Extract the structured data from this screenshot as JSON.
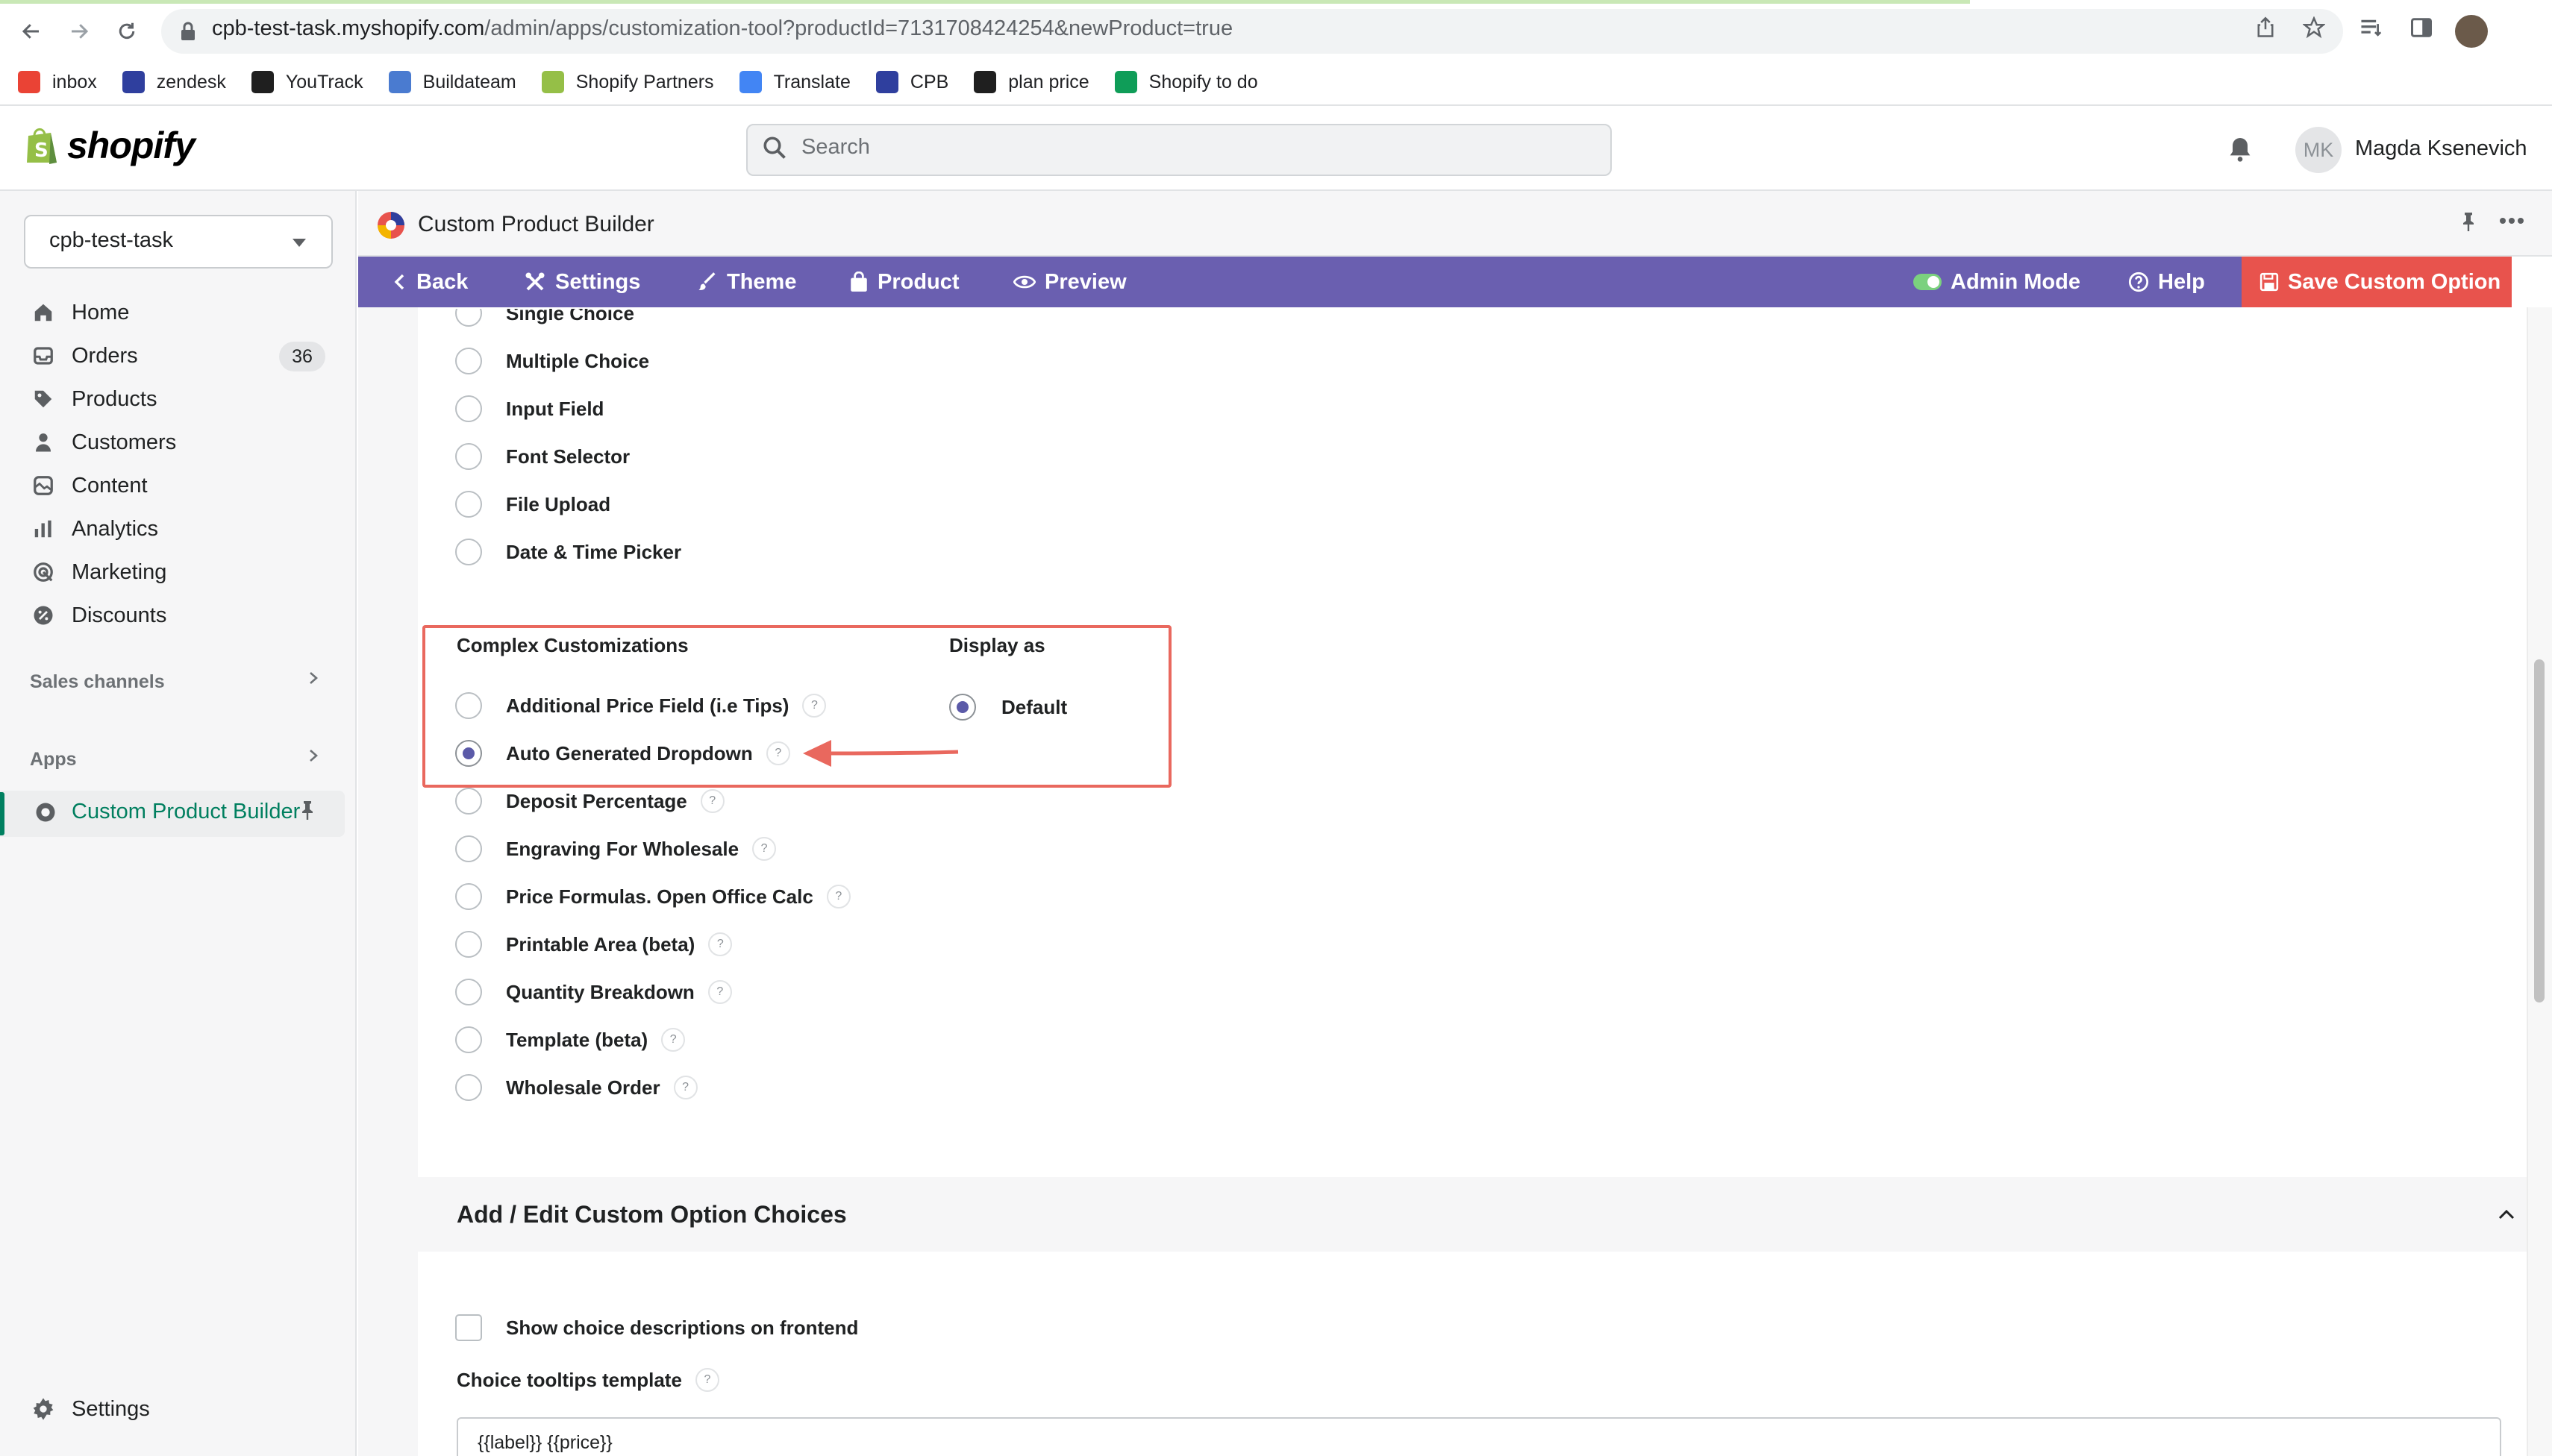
{
  "browser": {
    "url_host": "cpb-test-task.myshopify.com",
    "url_path": "/admin/apps/customization-tool?productId=7131708424254&newProduct=true",
    "bookmarks": [
      {
        "label": "inbox",
        "icon": "gmail-icon",
        "color": "#ea4335"
      },
      {
        "label": "zendesk",
        "icon": "zendesk-icon",
        "color": "#2f3f9e"
      },
      {
        "label": "YouTrack",
        "icon": "youtrack-icon",
        "color": "#1f1f1f"
      },
      {
        "label": "Buildateam",
        "icon": "buildateam-icon",
        "color": "#4a7bd0"
      },
      {
        "label": "Shopify Partners",
        "icon": "shopify-icon",
        "color": "#95bf47"
      },
      {
        "label": "Translate",
        "icon": "translate-icon",
        "color": "#4285f4"
      },
      {
        "label": "CPB",
        "icon": "cpb-icon",
        "color": "#2f3f9e"
      },
      {
        "label": "plan price",
        "icon": "shopify-bag-icon",
        "color": "#1f1f1f"
      },
      {
        "label": "Shopify to do",
        "icon": "sheets-icon",
        "color": "#0f9d58"
      }
    ]
  },
  "topbar": {
    "logo_text": "shopify",
    "search_placeholder": "Search",
    "avatar_initials": "MK",
    "user_name": "Magda Ksenevich"
  },
  "sidebar": {
    "store_name": "cpb-test-task",
    "nav": [
      {
        "label": "Home",
        "icon": "home-icon"
      },
      {
        "label": "Orders",
        "icon": "orders-icon",
        "badge": "36"
      },
      {
        "label": "Products",
        "icon": "tag-icon"
      },
      {
        "label": "Customers",
        "icon": "person-icon"
      },
      {
        "label": "Content",
        "icon": "content-icon"
      },
      {
        "label": "Analytics",
        "icon": "bar-chart-icon"
      },
      {
        "label": "Marketing",
        "icon": "target-icon"
      },
      {
        "label": "Discounts",
        "icon": "discount-icon"
      }
    ],
    "sales_channels_label": "Sales channels",
    "apps_label": "Apps",
    "active_app": "Custom Product Builder",
    "settings_label": "Settings"
  },
  "app_header": {
    "title": "Custom Product Builder"
  },
  "toolbar": {
    "back": "Back",
    "settings": "Settings",
    "theme": "Theme",
    "product": "Product",
    "preview": "Preview",
    "admin_mode": "Admin Mode",
    "help": "Help",
    "save": "Save Custom Option",
    "colors": {
      "bar": "#6a5fb0",
      "save": "#e8534d"
    }
  },
  "basic_options": [
    "Single Choice",
    "Multiple Choice",
    "Input Field",
    "Font Selector",
    "File Upload",
    "Date & Time Picker"
  ],
  "complex": {
    "heading": "Complex Customizations",
    "display_heading": "Display as",
    "display_default": "Default",
    "options": [
      {
        "label": "Additional Price Field (i.e Tips)",
        "selected": false
      },
      {
        "label": "Auto Generated Dropdown",
        "selected": true
      },
      {
        "label": "Deposit Percentage",
        "selected": false
      },
      {
        "label": "Engraving For Wholesale",
        "selected": false
      },
      {
        "label": "Price Formulas. Open Office Calc",
        "selected": false
      },
      {
        "label": "Printable Area (beta)",
        "selected": false
      },
      {
        "label": "Quantity Breakdown",
        "selected": false
      },
      {
        "label": "Template (beta)",
        "selected": false
      },
      {
        "label": "Wholesale Order",
        "selected": false
      }
    ],
    "help_glyph": "?",
    "annotation_color": "#e9685e"
  },
  "choices": {
    "title": "Add / Edit Custom Option Choices",
    "show_descriptions_label": "Show choice descriptions on frontend",
    "tooltip_template_label": "Choice tooltips template",
    "tooltip_template_value": "{{label}} {{price}}"
  }
}
